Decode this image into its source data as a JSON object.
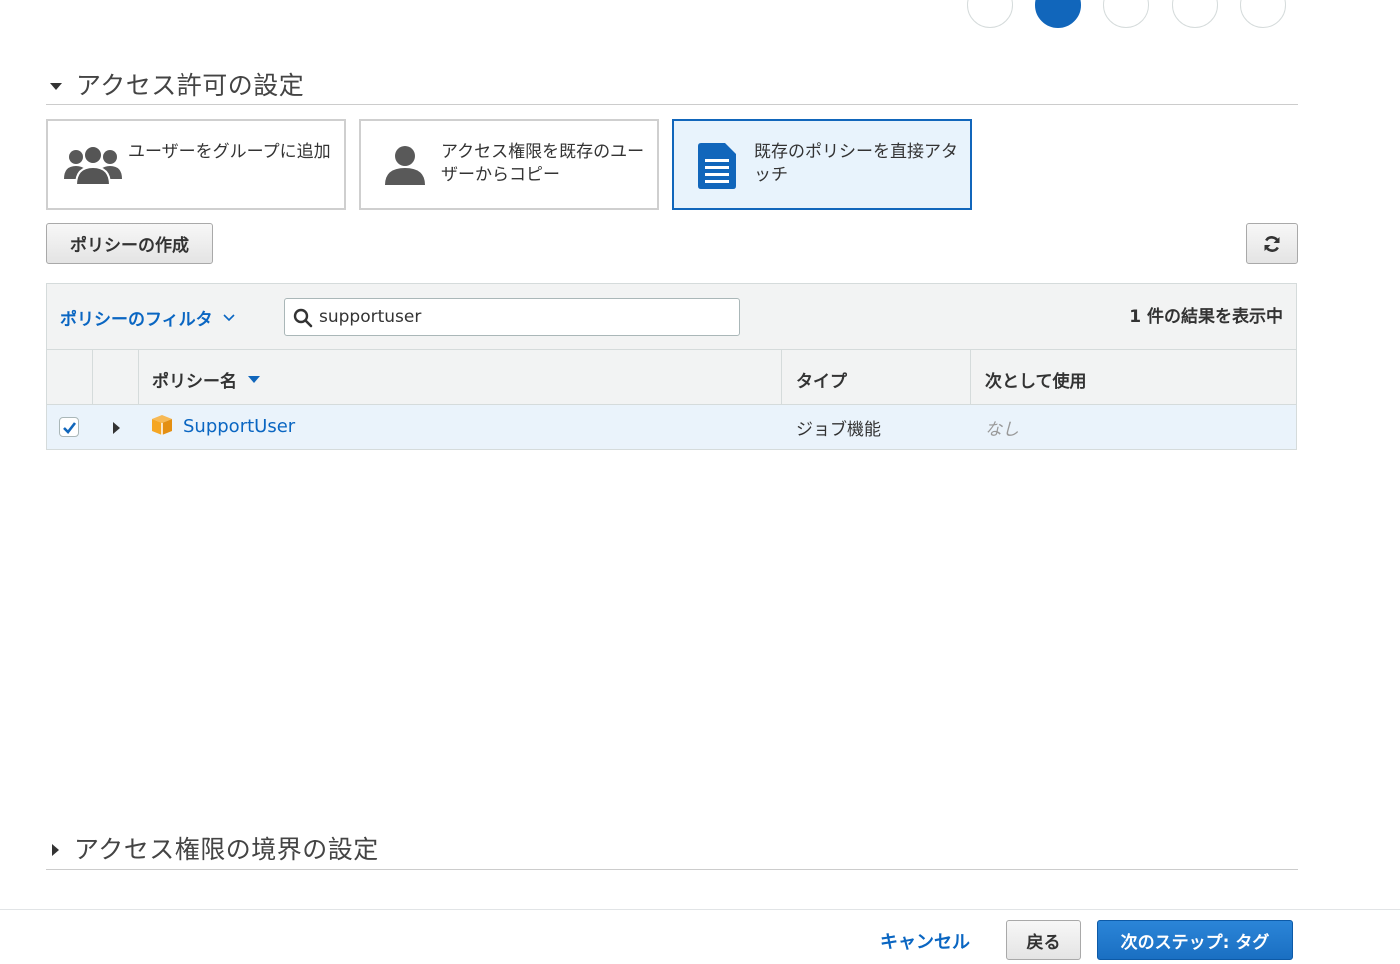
{
  "permissions_section": {
    "title": "アクセス許可の設定",
    "options": [
      {
        "label": "ユーザーをグループに追加",
        "icon": "users-group-icon",
        "selected": false
      },
      {
        "label": "アクセス権限を既存のユーザーからコピー",
        "icon": "user-icon",
        "selected": false
      },
      {
        "label": "既存のポリシーを直接アタッチ",
        "icon": "document-icon",
        "selected": true
      }
    ],
    "create_policy_label": "ポリシーの作成",
    "refresh_icon": "refresh-icon"
  },
  "policy_table": {
    "filter_label": "ポリシーのフィルタ",
    "search_value": "supportuser",
    "result_count": "1 件の結果を表示中",
    "columns": {
      "name": "ポリシー名",
      "type": "タイプ",
      "used_as": "次として使用"
    },
    "rows": [
      {
        "checked": true,
        "name": "SupportUser",
        "type": "ジョブ機能",
        "used_as": "なし",
        "icon": "aws-cube-icon"
      }
    ]
  },
  "boundary_section": {
    "title": "アクセス権限の境界の設定"
  },
  "footer": {
    "cancel_label": "キャンセル",
    "back_label": "戻る",
    "next_label": "次のステップ: タグ"
  },
  "colors": {
    "accent": "#1166bb",
    "link": "#0a66c2",
    "primary_button": "#1a73c8",
    "selected_bg": "#e8f3fc",
    "row_selected_bg": "#eaf3fb",
    "aws_orange": "#f5a623"
  }
}
